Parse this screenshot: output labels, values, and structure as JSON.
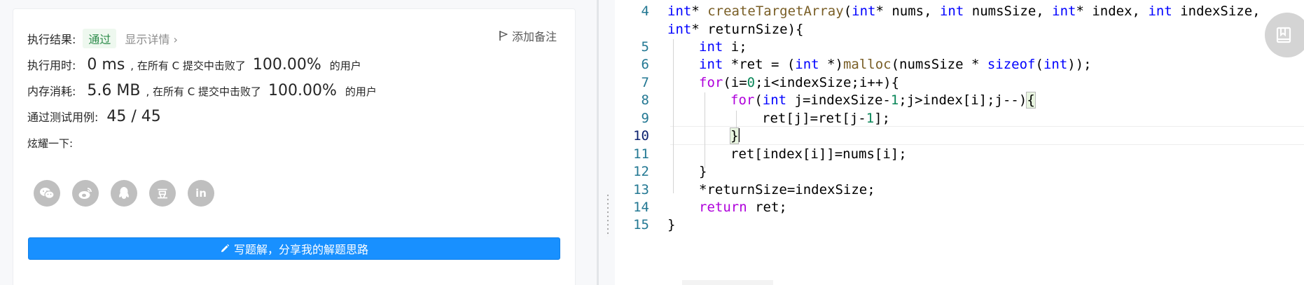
{
  "result": {
    "status_label": "执行结果:",
    "status_value": "通过",
    "details_link": "显示详情 ›",
    "add_note": "添加备注",
    "runtime_label": "执行用时:",
    "runtime_value": "0 ms",
    "runtime_beat_text": ", 在所有 C 提交中击败了",
    "runtime_percent": "100.00%",
    "runtime_users": "的用户",
    "memory_label": "内存消耗:",
    "memory_value": "5.6 MB",
    "memory_beat_text": ", 在所有 C 提交中击败了",
    "memory_percent": "100.00%",
    "memory_users": "的用户",
    "testcases_label": "通过测试用例:",
    "testcases_value": "45 / 45",
    "share_label": "炫耀一下:",
    "share_icons": [
      "wechat-icon",
      "weibo-icon",
      "qq-icon",
      "douban-icon",
      "linkedin-icon"
    ],
    "share_glyphs": [
      "",
      "",
      "",
      "豆",
      "in"
    ],
    "write_button": "写题解，分享我的解题思路"
  },
  "editor": {
    "line_numbers": [
      "4",
      "",
      "5",
      "6",
      "7",
      "8",
      "9",
      "10",
      "11",
      "12",
      "13",
      "14",
      "15"
    ],
    "active_line": "10",
    "code": {
      "l4_a": "int",
      "l4_b": "* ",
      "l4_fn": "createTargetArray",
      "l4_c": "(",
      "l4_d": "int",
      "l4_e": "* nums, ",
      "l4_f": "int",
      "l4_g": " numsSize, ",
      "l4_h": "int",
      "l4_i": "* index, ",
      "l4_j": "int",
      "l4_k": " indexSize,",
      "l4w_a": "int",
      "l4w_b": "* returnSize){",
      "l5_a": "int",
      "l5_b": " i;",
      "l6_a": "int",
      "l6_b": " *ret = (",
      "l6_c": "int",
      "l6_d": " *)",
      "l6_fn": "malloc",
      "l6_e": "(numsSize * ",
      "l6_f": "sizeof",
      "l6_g": "(",
      "l6_h": "int",
      "l6_i": "));",
      "l7_a": "for",
      "l7_b": "(i=",
      "l7_n": "0",
      "l7_c": ";i<indexSize;i++){",
      "l8_a": "for",
      "l8_b": "(",
      "l8_c": "int",
      "l8_d": " j=indexSize-",
      "l8_n": "1",
      "l8_e": ";j>index[i];j--)",
      "l8_br": "{",
      "l9_a": "ret[j]=ret[j-",
      "l9_n": "1",
      "l9_b": "];",
      "l10_a": "}",
      "l11_a": "ret[index[i]]=nums[i];",
      "l12_a": "}",
      "l13_a": "*returnSize=indexSize;",
      "l14_a": "return",
      "l14_b": " ret;",
      "l15_a": "}"
    }
  },
  "floating_button_icon": "bookmark-icon"
}
